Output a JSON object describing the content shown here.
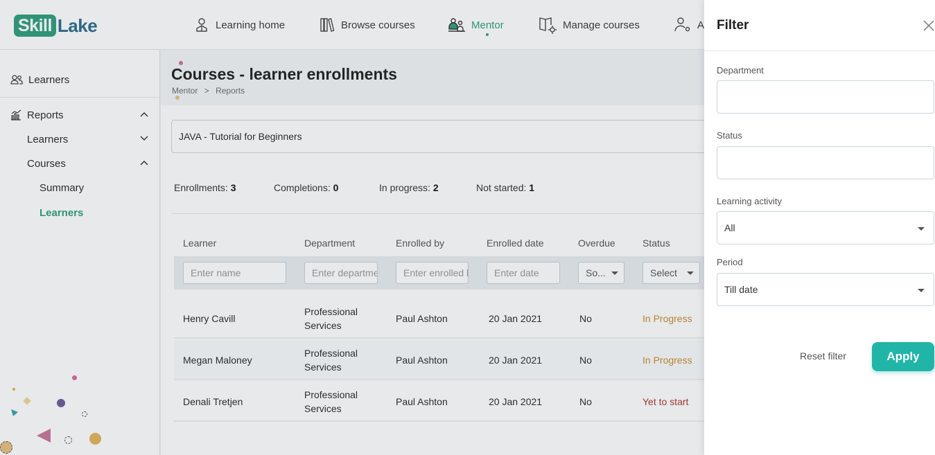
{
  "header": {
    "logo": {
      "part1": "Skill",
      "part2": "Lake"
    },
    "nav": [
      {
        "label": "Learning home",
        "icon": "user-icon"
      },
      {
        "label": "Browse courses",
        "icon": "books-icon"
      },
      {
        "label": "Mentor",
        "icon": "mentor-icon",
        "active": true
      },
      {
        "label": "Manage courses",
        "icon": "manage-courses-icon"
      },
      {
        "label": "A",
        "icon": "admin-user-icon"
      }
    ]
  },
  "sidebar": {
    "learners": "Learners",
    "reports": "Reports",
    "reports_learners": "Learners",
    "courses": "Courses",
    "summary": "Summary",
    "courses_learners": "Learners"
  },
  "page": {
    "title": "Courses - learner enrollments",
    "breadcrumb": [
      "Mentor",
      ">",
      "Reports"
    ],
    "course": "JAVA - Tutorial for Beginners",
    "stats": {
      "enrollments_label": "Enrollments:",
      "enrollments": "3",
      "completions_label": "Completions:",
      "completions": "0",
      "inprogress_label": "In progress:",
      "inprogress": "2",
      "notstarted_label": "Not started:",
      "notstarted": "1"
    }
  },
  "table": {
    "columns": [
      "Learner",
      "Department",
      "Enrolled by",
      "Enrolled date",
      "Overdue",
      "Status"
    ],
    "filters": {
      "learner_placeholder": "Enter name",
      "department_placeholder": "Enter department",
      "enrolledby_placeholder": "Enter enrolled by",
      "date_placeholder": "Enter date",
      "overdue_value": "So...",
      "status_value": "Select"
    },
    "rows": [
      {
        "learner": "Henry Cavill",
        "dept1": "Professional",
        "dept2": "Services",
        "enrolled_by": "Paul Ashton",
        "date": "20 Jan 2021",
        "overdue": "No",
        "status": "In Progress"
      },
      {
        "learner": "Megan Maloney",
        "dept1": "Professional",
        "dept2": "Services",
        "enrolled_by": "Paul Ashton",
        "date": "20 Jan 2021",
        "overdue": "No",
        "status": "In Progress"
      },
      {
        "learner": "Denali Tretjen",
        "dept1": "Professional",
        "dept2": "Services",
        "enrolled_by": "Paul Ashton",
        "date": "20 Jan 2021",
        "overdue": "No",
        "status": "Yet to start"
      }
    ]
  },
  "filter_panel": {
    "title": "Filter",
    "department_label": "Department",
    "department_value": "",
    "status_label": "Status",
    "status_value": "",
    "activity_label": "Learning activity",
    "activity_value": "All",
    "period_label": "Period",
    "period_value": "Till date",
    "reset_label": "Reset filter",
    "apply_label": "Apply"
  },
  "colors": {
    "brand_green": "#2f9e7d",
    "brand_blue": "#2d6c8e",
    "apply_teal": "#21b5a8",
    "in_progress": "#c98a2d",
    "yet_to_start": "#b0362e"
  }
}
